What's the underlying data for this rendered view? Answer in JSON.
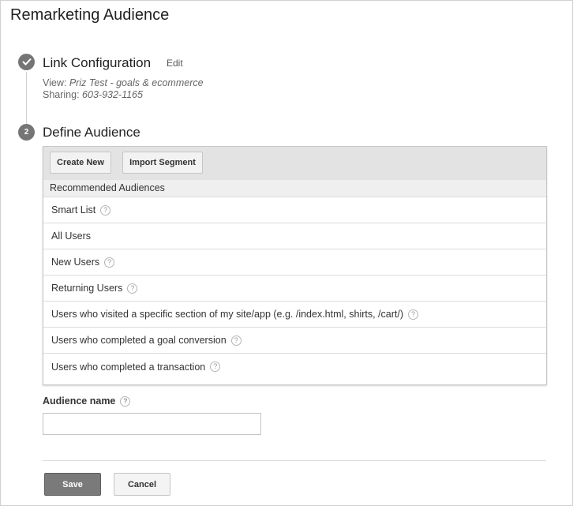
{
  "page": {
    "title": "Remarketing Audience"
  },
  "step1": {
    "title": "Link Configuration",
    "edit_label": "Edit",
    "view_label": "View:",
    "view_value": "Priz Test - goals & ecommerce",
    "sharing_label": "Sharing:",
    "sharing_value": "603-932-1165"
  },
  "step2": {
    "number": "2",
    "title": "Define Audience",
    "create_new_label": "Create New",
    "import_segment_label": "Import Segment",
    "recommended_header": "Recommended Audiences",
    "audiences": [
      {
        "label": "Smart List",
        "help": true
      },
      {
        "label": "All Users",
        "help": false
      },
      {
        "label": "New Users",
        "help": true
      },
      {
        "label": "Returning Users",
        "help": true
      },
      {
        "label": "Users who visited a specific section of my site/app (e.g. /index.html, shirts, /cart/)",
        "help": true
      },
      {
        "label": "Users who completed a goal conversion",
        "help": true
      },
      {
        "label": "Users who completed a transaction",
        "help": true
      }
    ]
  },
  "audience_name": {
    "label": "Audience name",
    "value": "",
    "placeholder": ""
  },
  "actions": {
    "save_label": "Save",
    "cancel_label": "Cancel"
  },
  "icons": {
    "check": "checkmark-icon",
    "help": "question-mark-icon"
  },
  "colors": {
    "step_circle": "#757575",
    "save_button": "#7a7a7a",
    "toolbar": "#e3e3e3"
  }
}
